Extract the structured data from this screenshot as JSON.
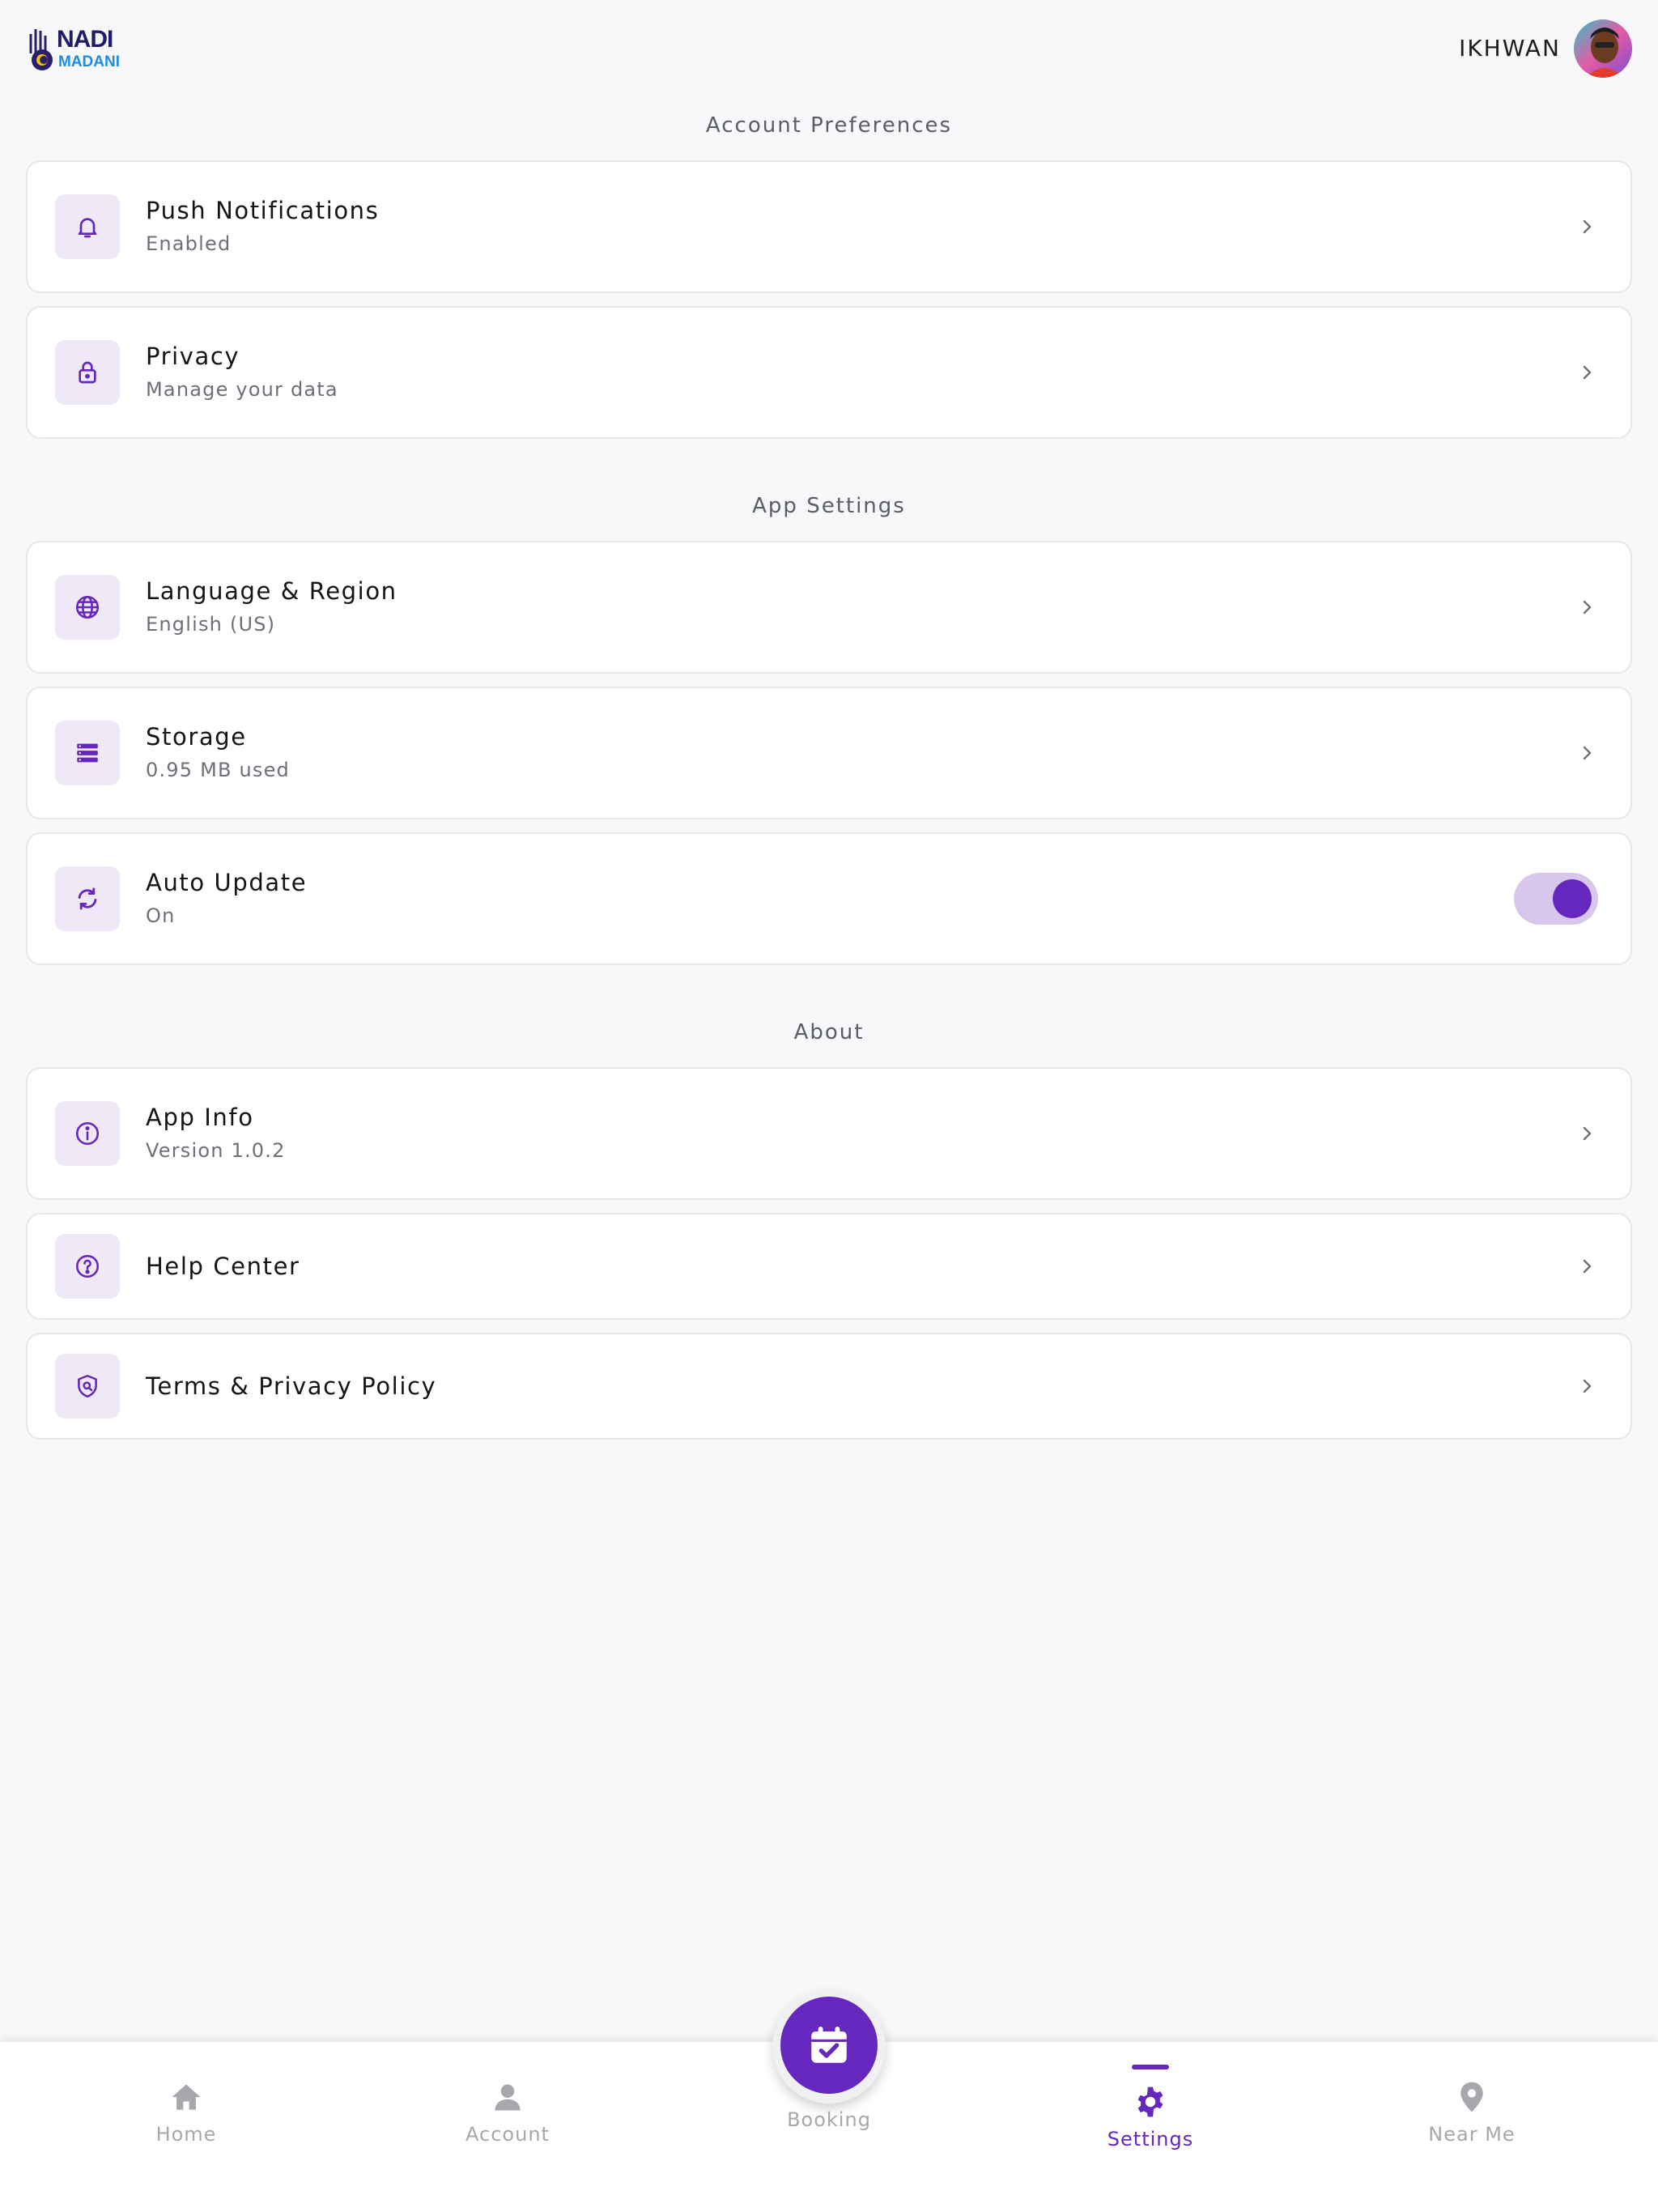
{
  "header": {
    "logo_top": "NADI",
    "logo_bottom": "MADANI",
    "user_name": "IKHWAN"
  },
  "sections": {
    "account": "Account Preferences",
    "app": "App Settings",
    "about": "About"
  },
  "items": {
    "push": {
      "title": "Push Notifications",
      "subtitle": "Enabled",
      "icon": "bell-icon"
    },
    "privacy": {
      "title": "Privacy",
      "subtitle": "Manage your data",
      "icon": "lock-icon"
    },
    "language": {
      "title": "Language & Region",
      "subtitle": "English (US)",
      "icon": "globe-icon"
    },
    "storage": {
      "title": "Storage",
      "subtitle": "0.95 MB used",
      "icon": "storage-icon"
    },
    "auto_update": {
      "title": "Auto Update",
      "subtitle": "On",
      "icon": "sync-icon",
      "toggle_on": true
    },
    "app_info": {
      "title": "App Info",
      "subtitle": "Version 1.0.2",
      "icon": "info-icon"
    },
    "help": {
      "title": "Help Center",
      "icon": "help-icon"
    },
    "terms": {
      "title": "Terms & Privacy Policy",
      "icon": "shield-icon"
    }
  },
  "nav": {
    "home": "Home",
    "account": "Account",
    "booking": "Booking",
    "settings": "Settings",
    "near_me": "Near Me",
    "active": "settings"
  },
  "colors": {
    "accent": "#6527bd",
    "icon_bg": "#eee8f7",
    "toggle_track": "#d8c6ec",
    "nav_inactive": "#a6a8ad"
  }
}
